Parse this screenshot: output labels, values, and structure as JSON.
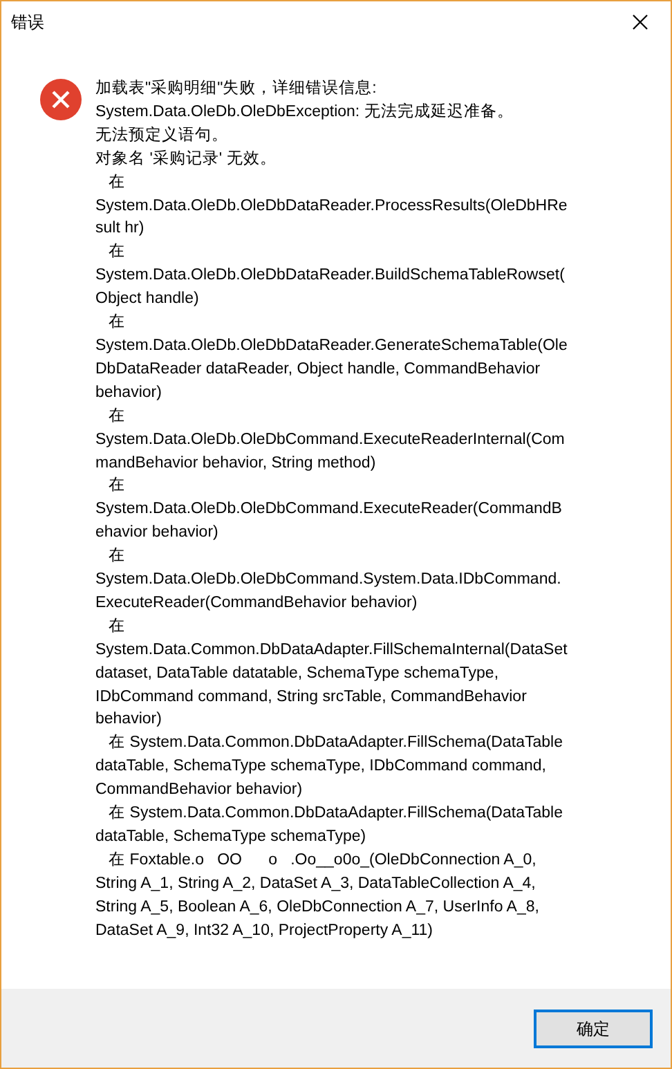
{
  "window": {
    "title": "错误"
  },
  "message_lines": [
    "加载表\"采购明细\"失败，详细错误信息:",
    "System.Data.OleDb.OleDbException: 无法完成延迟准备。",
    "无法预定义语句。",
    "对象名 '采购记录' 无效。",
    "   在",
    "System.Data.OleDb.OleDbDataReader.ProcessResults(OleDbHRe",
    "sult hr)",
    "   在",
    "System.Data.OleDb.OleDbDataReader.BuildSchemaTableRowset(",
    "Object handle)",
    "   在",
    "System.Data.OleDb.OleDbDataReader.GenerateSchemaTable(Ole",
    "DbDataReader dataReader, Object handle, CommandBehavior",
    "behavior)",
    "   在",
    "System.Data.OleDb.OleDbCommand.ExecuteReaderInternal(Com",
    "mandBehavior behavior, String method)",
    "   在",
    "System.Data.OleDb.OleDbCommand.ExecuteReader(CommandB",
    "ehavior behavior)",
    "   在",
    "System.Data.OleDb.OleDbCommand.System.Data.IDbCommand.",
    "ExecuteReader(CommandBehavior behavior)",
    "   在",
    "System.Data.Common.DbDataAdapter.FillSchemaInternal(DataSet",
    "dataset, DataTable datatable, SchemaType schemaType,",
    "IDbCommand command, String srcTable, CommandBehavior",
    "behavior)",
    "   在 System.Data.Common.DbDataAdapter.FillSchema(DataTable",
    "dataTable, SchemaType schemaType, IDbCommand command,",
    "CommandBehavior behavior)",
    "   在 System.Data.Common.DbDataAdapter.FillSchema(DataTable",
    "dataTable, SchemaType schemaType)",
    "   在 Foxtable.o   OO      o   .Oo__o0o_(OleDbConnection A_0,",
    "String A_1, String A_2, DataSet A_3, DataTableCollection A_4,",
    "String A_5, Boolean A_6, OleDbConnection A_7, UserInfo A_8,",
    "DataSet A_9, Int32 A_10, ProjectProperty A_11)"
  ],
  "buttons": [
    {
      "label": "确定",
      "selected": true
    }
  ]
}
